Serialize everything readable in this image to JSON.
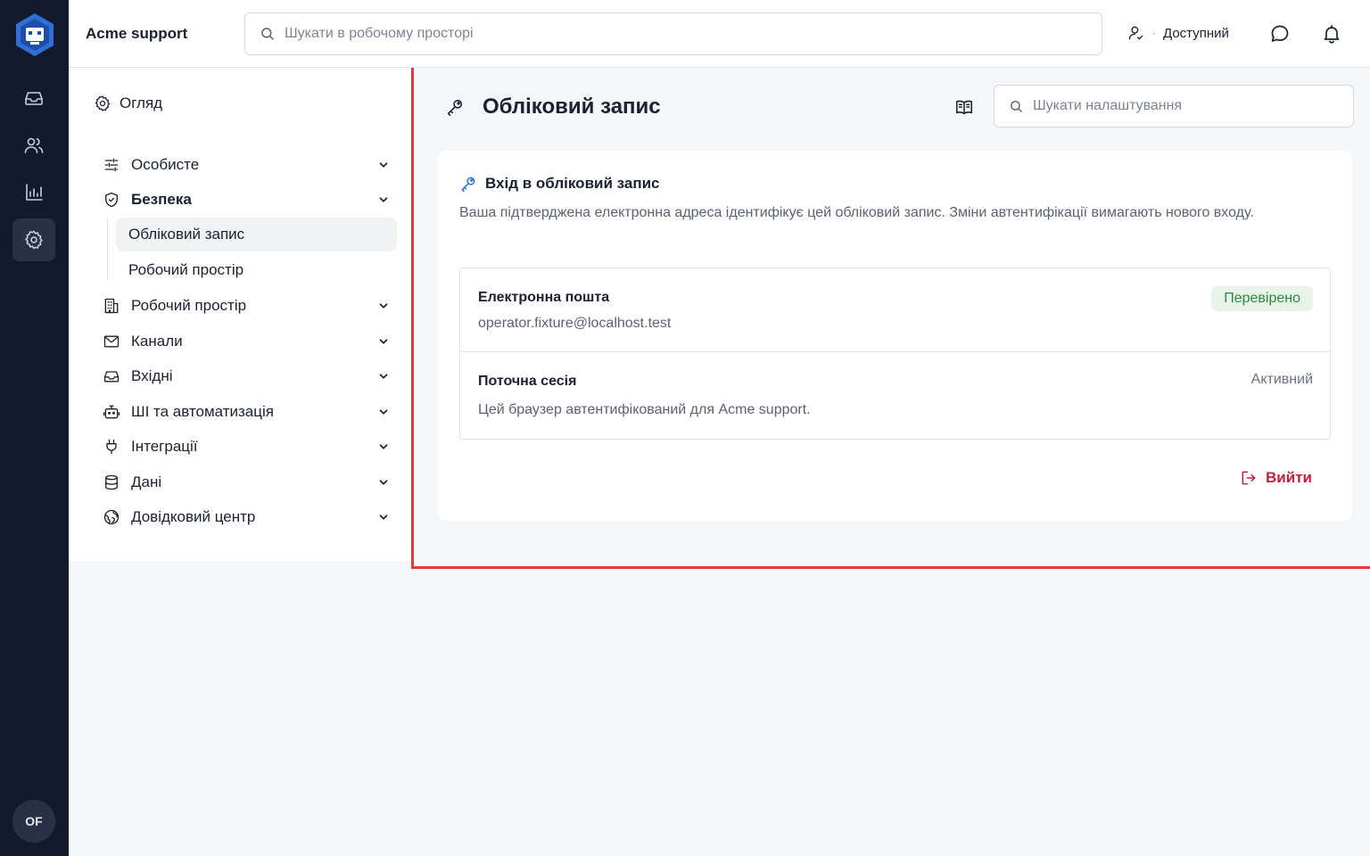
{
  "app": {
    "brand": "Acme support",
    "user_initials": "OF"
  },
  "rail": {
    "items": [
      {
        "name": "inbox-icon"
      },
      {
        "name": "contacts-icon"
      },
      {
        "name": "reports-icon"
      },
      {
        "name": "settings-icon",
        "active": true
      }
    ]
  },
  "topbar": {
    "search_placeholder": "Шукати в робочому просторі",
    "status_label": "Доступний",
    "icons": [
      "user-status-icon",
      "chat-icon",
      "bell-icon"
    ]
  },
  "nav": {
    "overview": "Огляд",
    "items": [
      {
        "label": "Особисте",
        "icon": "sliders-icon"
      },
      {
        "label": "Безпека",
        "icon": "shield-icon",
        "expanded": true
      },
      {
        "label": "Робочий простір",
        "icon": "building-icon"
      },
      {
        "label": "Канали",
        "icon": "mail-icon"
      },
      {
        "label": "Вхідні",
        "icon": "inbox-icon"
      },
      {
        "label": "ШІ та автоматизація",
        "icon": "bot-icon"
      },
      {
        "label": "Інтеграції",
        "icon": "plug-icon"
      },
      {
        "label": "Дані",
        "icon": "database-icon"
      },
      {
        "label": "Довідковий центр",
        "icon": "globe-icon"
      }
    ],
    "security_sub": [
      {
        "label": "Обліковий запис",
        "active": true
      },
      {
        "label": "Робочий простір"
      }
    ]
  },
  "main": {
    "title": "Обліковий запис",
    "settings_search_placeholder": "Шукати налаштування",
    "section": {
      "title": "Вхід в обліковий запис",
      "description": "Ваша підтверджена електронна адреса ідентифікує цей обліковий запис. Зміни автентифікації вимагають нового входу.",
      "email_label": "Електронна пошта",
      "email_value": "operator.fixture@localhost.test",
      "email_badge": "Перевірено",
      "session_label": "Поточна сесія",
      "session_value": "Цей браузер автентифікований для Acme support.",
      "session_state": "Активний",
      "logout_label": "Вийти"
    }
  },
  "colors": {
    "rail_bg": "#141a2e",
    "accent_blue": "#2f6fd6",
    "danger": "#c4203e",
    "success": "#2b8a3e",
    "highlight_border": "#e23a3a"
  }
}
